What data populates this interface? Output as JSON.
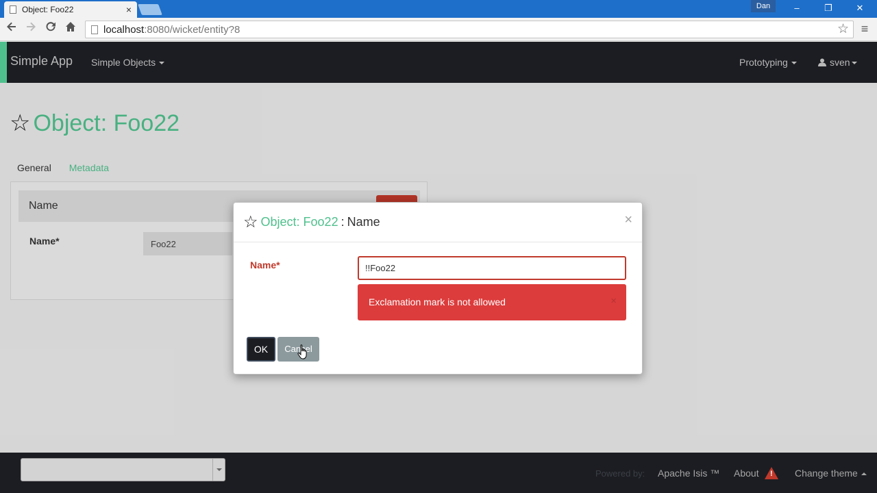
{
  "browser": {
    "tab_title": "Object: Foo22",
    "tab_close": "×",
    "window_user": "Dan",
    "url_host": "localhost",
    "url_rest": ":8080/wicket/entity?8",
    "minimize": "–",
    "restore": "❐",
    "close": "✕"
  },
  "navbar": {
    "brand": "Simple App",
    "simple_objects": "Simple Objects",
    "prototyping": "Prototyping",
    "user": "sven"
  },
  "page": {
    "title": "Object: Foo22",
    "tabs": [
      {
        "label": "General"
      },
      {
        "label": "Metadata"
      }
    ],
    "panel_header": "Name",
    "field_label": "Name*",
    "field_value": "Foo22"
  },
  "modal": {
    "title_object": "Object: Foo22",
    "title_sep": ":",
    "title_property": "Name",
    "close": "×",
    "field_label": "Name*",
    "input_value": "!!Foo22",
    "error_message": "Exclamation mark is not allowed",
    "error_close": "×",
    "ok_label": "OK",
    "cancel_label": "Cancel"
  },
  "footer": {
    "powered_by": "Powered by:",
    "apache_isis": "Apache Isis ™",
    "about": "About",
    "change_theme": "Change theme"
  },
  "colors": {
    "accent": "#4fc08d",
    "navbar_bg": "#1c1d22",
    "error": "#dc3c3c",
    "chrome_blue": "#1e6fc9"
  },
  "icons": [
    "doc-icon",
    "back-icon",
    "forward-icon",
    "reload-icon",
    "home-icon",
    "star-icon",
    "menu-icon",
    "user-icon",
    "warning-icon"
  ]
}
